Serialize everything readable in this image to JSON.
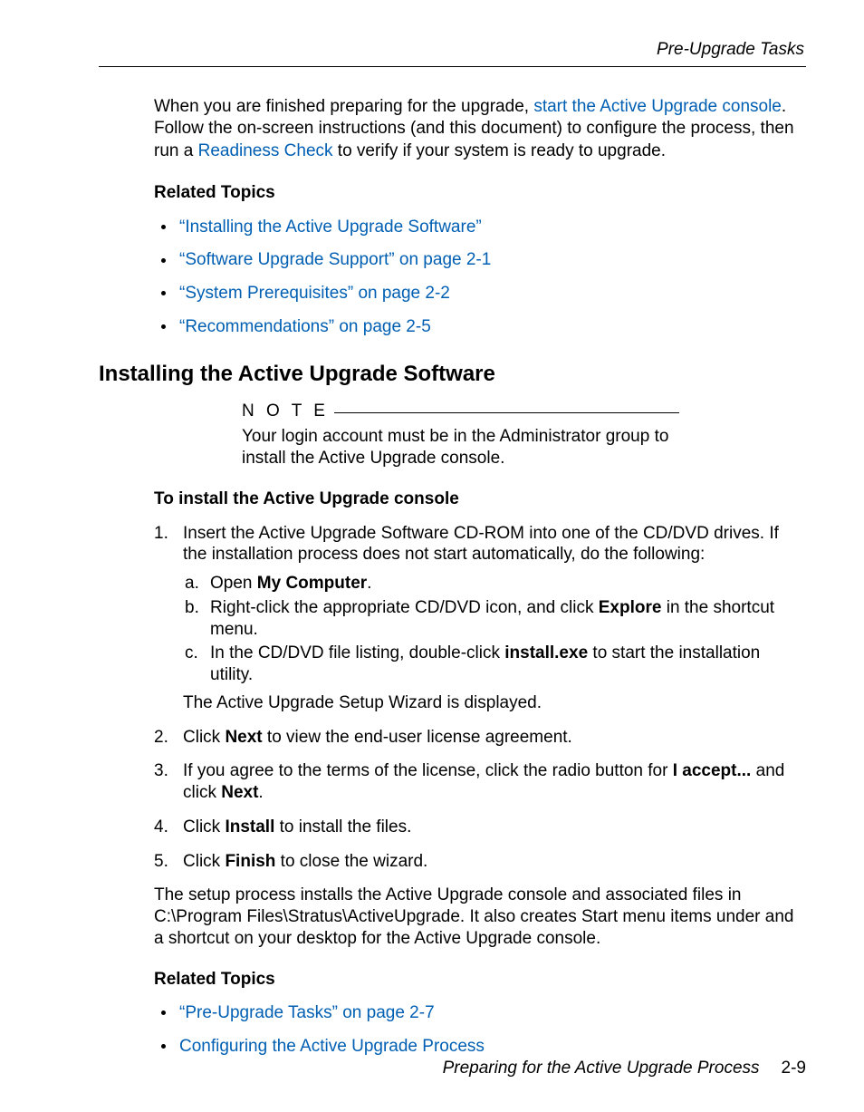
{
  "header": {
    "running_title": "Pre-Upgrade Tasks"
  },
  "intro": {
    "text_before_link1": "When you are finished preparing for the upgrade, ",
    "link1": "start the Active Upgrade console",
    "text_after_link1": ". Follow the on-screen instructions (and this document) to configure the process, then run a ",
    "link2": "Readiness Check",
    "text_after_link2": " to verify if your system is ready to upgrade."
  },
  "relatedTopics1": {
    "heading": "Related Topics",
    "items": [
      "“Installing the Active Upgrade Software”",
      "“Software Upgrade Support” on page 2-1",
      "“System Prerequisites” on page 2-2",
      "“Recommendations” on page 2-5"
    ]
  },
  "section": {
    "title": "Installing the Active Upgrade Software",
    "note_label": "N O T E",
    "note_text": "Your login account must be in the Administrator group to install the Active Upgrade console.",
    "install_heading": "To install the Active Upgrade console"
  },
  "steps": {
    "s1": {
      "text": "Insert the Active Upgrade Software CD-ROM into one of the CD/DVD drives. If the installation process does not start automatically, do the following:",
      "a_pre": "Open ",
      "a_bold": "My Computer",
      "a_post": ".",
      "b_pre": "Right-click the appropriate CD/DVD icon, and click ",
      "b_bold": "Explore",
      "b_post": " in the shortcut menu.",
      "c_pre": "In the CD/DVD file listing, double-click ",
      "c_bold": "install.exe",
      "c_post": " to start the installation utility.",
      "after": "The Active Upgrade Setup Wizard is displayed."
    },
    "s2": {
      "pre": "Click ",
      "bold": "Next",
      "post": " to view the end-user license agreement."
    },
    "s3": {
      "pre": "If you agree to the terms of the license, click the radio button for ",
      "bold1": "I accept...",
      "mid": " and click ",
      "bold2": "Next",
      "post": "."
    },
    "s4": {
      "pre": "Click ",
      "bold": "Install",
      "post": " to install the files."
    },
    "s5": {
      "pre": "Click ",
      "bold": "Finish",
      "post": " to close the wizard."
    }
  },
  "closing": "The setup process installs the Active Upgrade console and associated files in C:\\Program Files\\Stratus\\ActiveUpgrade. It also creates Start menu items under  and a shortcut on your desktop for the Active Upgrade console.",
  "relatedTopics2": {
    "heading": "Related Topics",
    "items": [
      "“Pre-Upgrade Tasks” on page 2-7",
      "Configuring the Active Upgrade Process"
    ]
  },
  "footer": {
    "title": "Preparing for the Active Upgrade Process",
    "page": "2-9"
  }
}
